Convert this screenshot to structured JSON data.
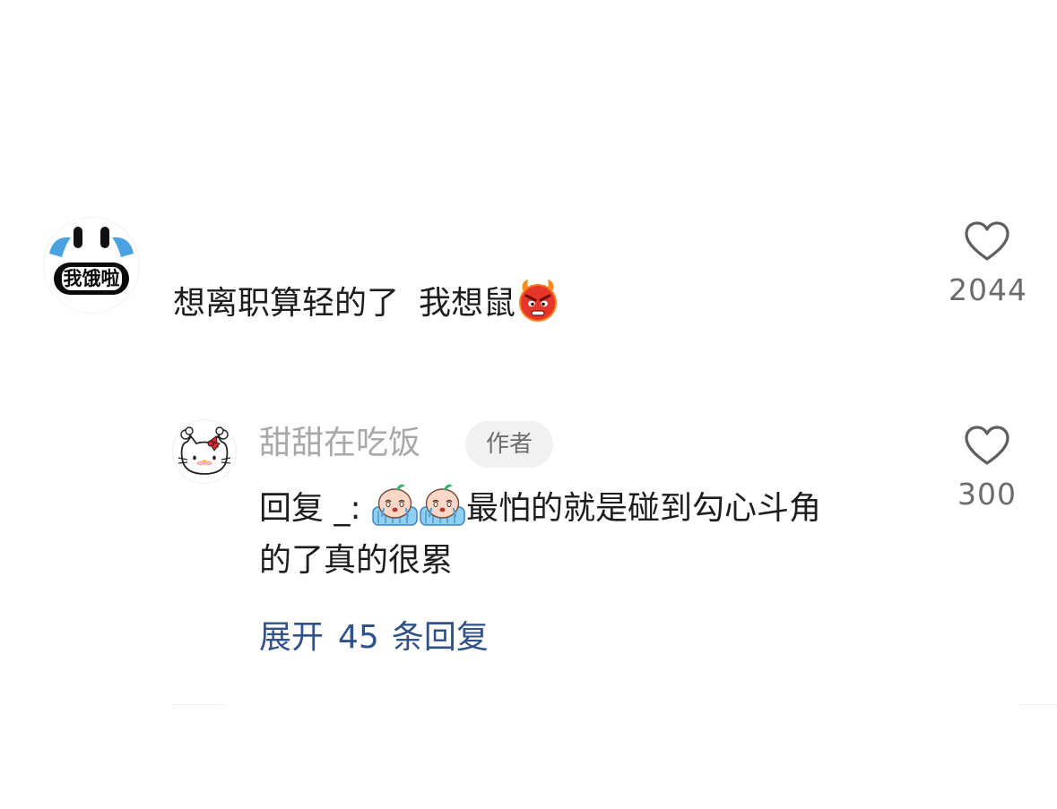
{
  "comment": {
    "avatar_text": "我饿啦",
    "text_part1": "想离职算轻的了",
    "text_part2": "我想鼠",
    "emoji": "angry-devil-emoji",
    "like_count": "2044"
  },
  "reply": {
    "author": "甜甜在吃饭",
    "author_badge": "作者",
    "prefix": "回复 _:",
    "text_line1": "最怕的就是碰到勾心斗角",
    "text_line2": "的了真的很累",
    "emoji": "crying-peach-emoji",
    "like_count": "300"
  },
  "expand": {
    "label_before": "展开",
    "count": "45",
    "label_after": "条回复"
  },
  "colors": {
    "link": "#30518a",
    "muted": "#a8a8a8",
    "count": "#6b6b6b"
  }
}
